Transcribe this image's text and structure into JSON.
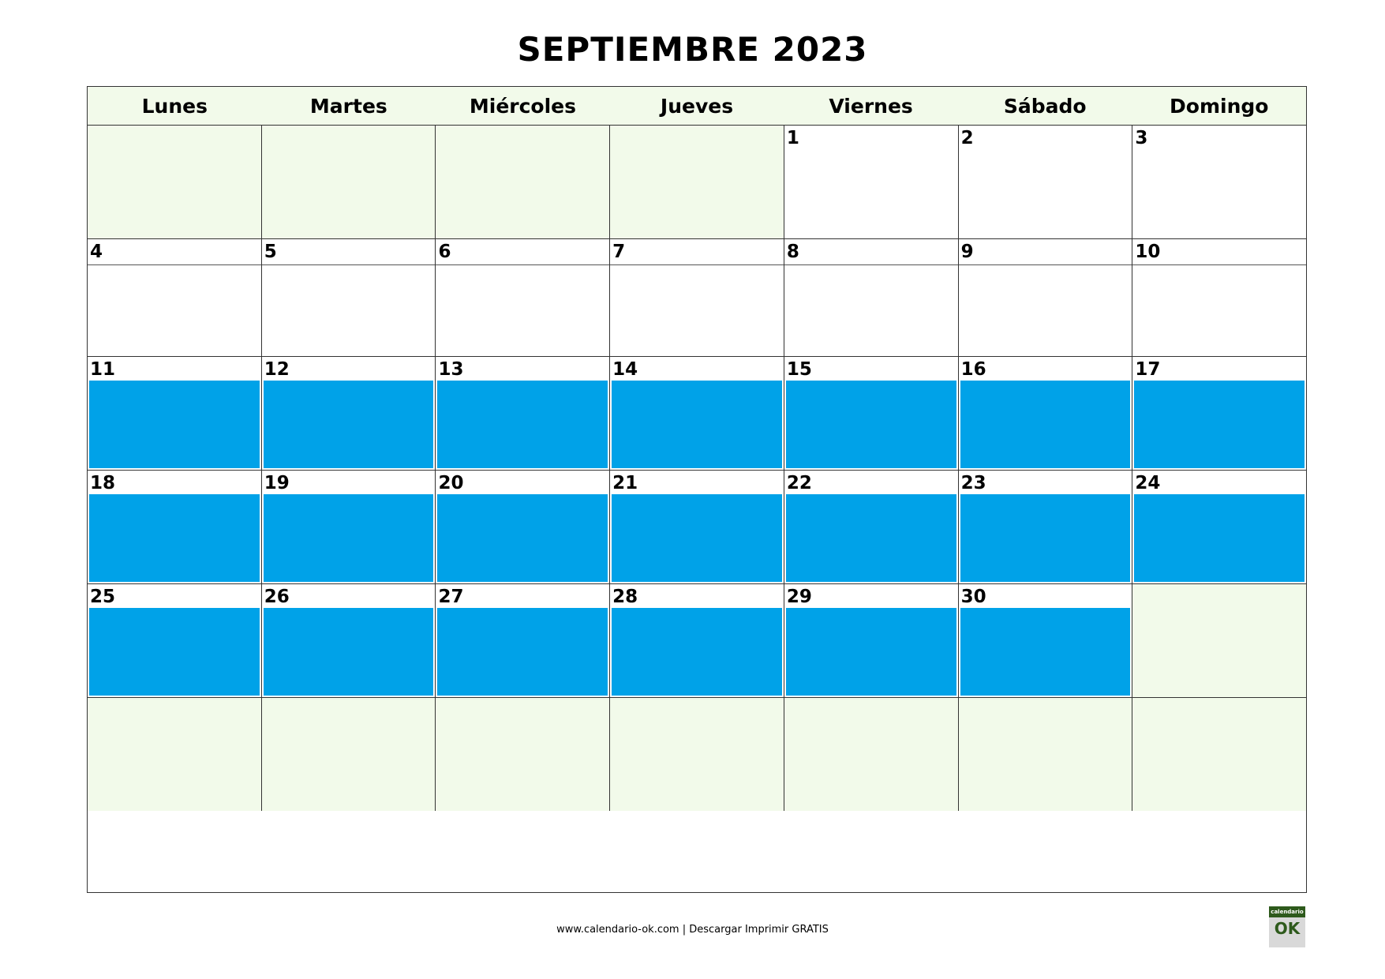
{
  "title": "SEPTIEMBRE 2023",
  "weekdays": [
    "Lunes",
    "Martes",
    "Miércoles",
    "Jueves",
    "Viernes",
    "Sábado",
    "Domingo"
  ],
  "weeks": [
    [
      "",
      "",
      "",
      "",
      "1",
      "2",
      "3"
    ],
    [
      "4",
      "5",
      "6",
      "7",
      "8",
      "9",
      "10"
    ],
    [
      "11",
      "12",
      "13",
      "14",
      "15",
      "16",
      "17"
    ],
    [
      "18",
      "19",
      "20",
      "21",
      "22",
      "23",
      "24"
    ],
    [
      "25",
      "26",
      "27",
      "28",
      "29",
      "30",
      ""
    ],
    [
      "",
      "",
      "",
      "",
      "",
      "",
      ""
    ]
  ],
  "highlighted_weeks": [
    2,
    3,
    4
  ],
  "colors": {
    "highlight": "#00a2e8",
    "empty": "#f2faea",
    "logo": "#2e5a1c"
  },
  "footer": "www.calendario-ok.com | Descargar Imprimir GRATIS",
  "logo": {
    "top": "calendario",
    "main": "OK"
  }
}
